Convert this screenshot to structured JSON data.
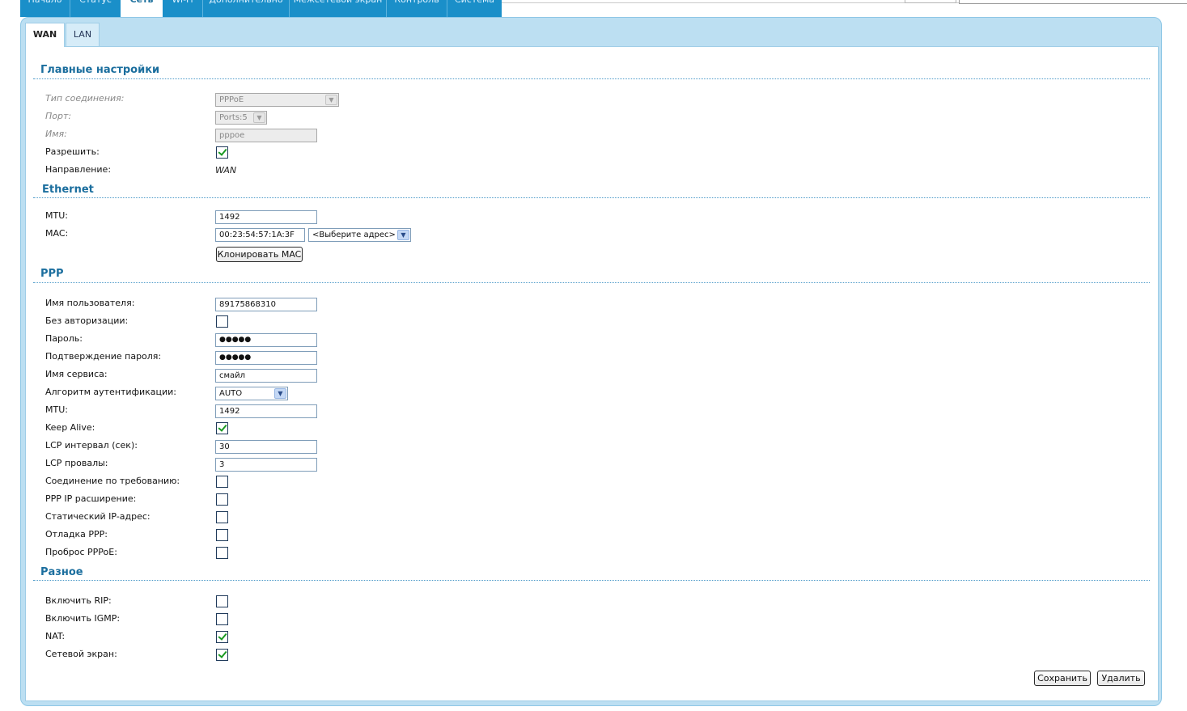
{
  "nav": {
    "items": [
      "Начало",
      "Статус",
      "Сеть",
      "Wi-Fi",
      "Дополнительно",
      "Межсетевой экран",
      "Контроль",
      "Система"
    ],
    "active": "Сеть"
  },
  "tabs": {
    "wan": "WAN",
    "lan": "LAN"
  },
  "main": {
    "title": "Главные настройки",
    "conn_type_label": "Тип соединения:",
    "conn_type_value": "PPPoE",
    "port_label": "Порт:",
    "port_value": "Ports:5",
    "name_label": "Имя:",
    "name_value": "pppoe",
    "enable_label": "Разрешить:",
    "enable_checked": true,
    "direction_label": "Направление:",
    "direction_value": "WAN"
  },
  "ethernet": {
    "title": "Ethernet",
    "mtu_label": "MTU:",
    "mtu_value": "1492",
    "mac_label": "MAC:",
    "mac_value": "00:23:54:57:1A:3F",
    "mac_select": "<Выберите адрес>",
    "clone_button": "Клонировать MAC"
  },
  "ppp": {
    "title": "PPP",
    "username_label": "Имя пользователя:",
    "username_value": "89175868310",
    "noauth_label": "Без авторизации:",
    "password_label": "Пароль:",
    "password_value": "●●●●●",
    "confirm_label": "Подтверждение пароля:",
    "confirm_value": "●●●●●",
    "service_label": "Имя сервиса:",
    "service_value": "смайл",
    "auth_label": "Алгоритм аутентификации:",
    "auth_value": "AUTO",
    "mtu_label": "MTU:",
    "mtu_value": "1492",
    "keepalive_label": "Keep Alive:",
    "lcp_interval_label": "LCP интервал (сек):",
    "lcp_interval_value": "30",
    "lcp_fail_label": "LCP провалы:",
    "lcp_fail_value": "3",
    "on_demand_label": "Соединение по требованию:",
    "ip_ext_label": "PPP IP расширение:",
    "static_ip_label": "Статический IP-адрес:",
    "debug_label": "Отладка PPP:",
    "passthrough_label": "Проброс PPPoE:"
  },
  "misc": {
    "title": "Разное",
    "rip_label": "Включить RIP:",
    "igmp_label": "Включить IGMP:",
    "nat_label": "NAT:",
    "firewall_label": "Сетевой экран:"
  },
  "buttons": {
    "save": "Сохранить",
    "delete": "Удалить"
  }
}
